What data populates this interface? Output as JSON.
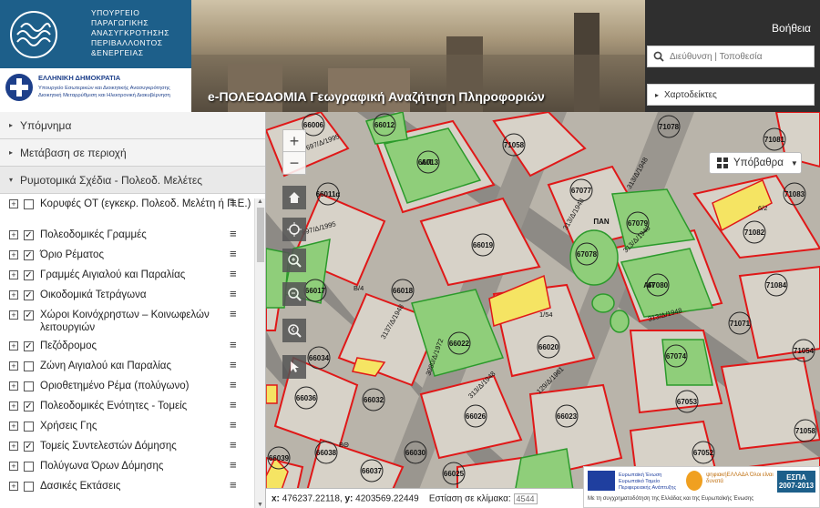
{
  "header": {
    "ministry_lines": [
      "ΥΠΟΥΡΓΕΙΟ",
      "ΠΑΡΑΓΩΓΙΚΗΣ",
      "ΑΝΑΣΥΓΚΡΟΤΗΣΗΣ",
      "ΠΕΡΙΒΑΛΛΟΝΤΟΣ",
      "&ΕΝΕΡΓΕΙΑΣ"
    ],
    "republic_title": "ΕΛΛΗΝΙΚΗ ΔΗΜΟΚΡΑΤΙΑ",
    "republic_sub": "Υπουργείο Εσωτερικών και Διοικητικής Ανασυγκρότησης Διοικητική Μεταρρύθμιση και Ηλεκτρονική Διακυβέρνηση",
    "app_title": "e-ΠΟΛΕΟΔΟΜΙΑ Γεωγραφική Αναζήτηση Πληροφοριών",
    "help_label": "Βοήθεια",
    "search_placeholder": "Διεύθυνση | Τοποθεσία",
    "maps_button": "Χαρτοδείκτες"
  },
  "sidebar": {
    "sections": [
      {
        "label": "Υπόμνημα",
        "open": false
      },
      {
        "label": "Μετάβαση σε περιοχή",
        "open": false
      },
      {
        "label": "Ρυμοτομικά Σχέδια - Πολεοδ. Μελέτες",
        "open": true
      }
    ],
    "layers": [
      {
        "label": "Κορυφές ΟΤ (εγκεκρ. Πολεοδ. Μελέτη ή Π.Ε.)",
        "checked": false
      },
      {
        "label": "Πολεοδομικές Γραμμές",
        "checked": true
      },
      {
        "label": "Όριο Ρέματος",
        "checked": true
      },
      {
        "label": "Γραμμές Αιγιαλού και Παραλίας",
        "checked": true
      },
      {
        "label": "Οικοδομικά Τετράγωνα",
        "checked": true
      },
      {
        "label": "Χώροι Κοινόχρηστων – Κοινωφελών λειτουργιών",
        "checked": true
      },
      {
        "label": "Πεζόδρομος",
        "checked": true
      },
      {
        "label": "Ζώνη Αιγιαλού και Παραλίας",
        "checked": false
      },
      {
        "label": "Οριοθετημένο Ρέμα (πολύγωνο)",
        "checked": false
      },
      {
        "label": "Πολεοδομικές Ενότητες - Τομείς",
        "checked": true
      },
      {
        "label": "Χρήσεις Γης",
        "checked": false
      },
      {
        "label": "Τομείς Συντελεστών Δόμησης",
        "checked": true
      },
      {
        "label": "Πολύγωνα Όρων Δόμησης",
        "checked": false
      },
      {
        "label": "Δασικές Εκτάσεις",
        "checked": false
      }
    ]
  },
  "map": {
    "basemap_label": "Υπόβαθρα",
    "coord_x_label": "x:",
    "coord_x": "476237.22118,",
    "coord_y_label": "y:",
    "coord_y": "4203569.22449",
    "scale_label": "Εστίαση σε κλίμακα:",
    "scale_value": "4544",
    "block_labels": [
      "66006",
      "66012",
      "71058",
      "71078",
      "71081",
      "66011α",
      "66013",
      "67077",
      "71083",
      "66019",
      "67079",
      "71082",
      "67078",
      "66017",
      "66018",
      "67080",
      "71084",
      "71071",
      "66022",
      "66020",
      "66034",
      "67074",
      "71054",
      "66036",
      "66032",
      "66026",
      "66023",
      "67053",
      "71058",
      "66039",
      "66038",
      "66030",
      "67052",
      "66037",
      "66025",
      "71065",
      "ΑΠ",
      "ΠΑΝ",
      "ΑΠ"
    ],
    "road_labels": [
      "697/Δ/1995",
      "697/Δ/1995",
      "313/Δ/1948",
      "313/Δ/1948",
      "313/Δ/1948",
      "313/Δ/1948",
      "3137/Δ/1948",
      "3080/Δ/1972",
      "129/Δ/1961",
      "313/Δ/1948",
      "1/54",
      "6/2",
      "Β/4",
      "ΒΘ"
    ]
  },
  "footer_logos": {
    "eu_text": "Ευρωπαϊκή Ένωση Ευρωπαϊκό Ταμείο Περιφερειακής Ανάπτυξης",
    "ep_text": "ψηφιακήΕΛΛΑΔΑ Όλοι είναι δυνατά",
    "espa_text": "ΕΣΠΑ 2007-2013",
    "cofinance_text": "Με τη συγχρηματοδότηση της Ελλάδας και της Ευρωπαϊκής Ένωσης"
  }
}
